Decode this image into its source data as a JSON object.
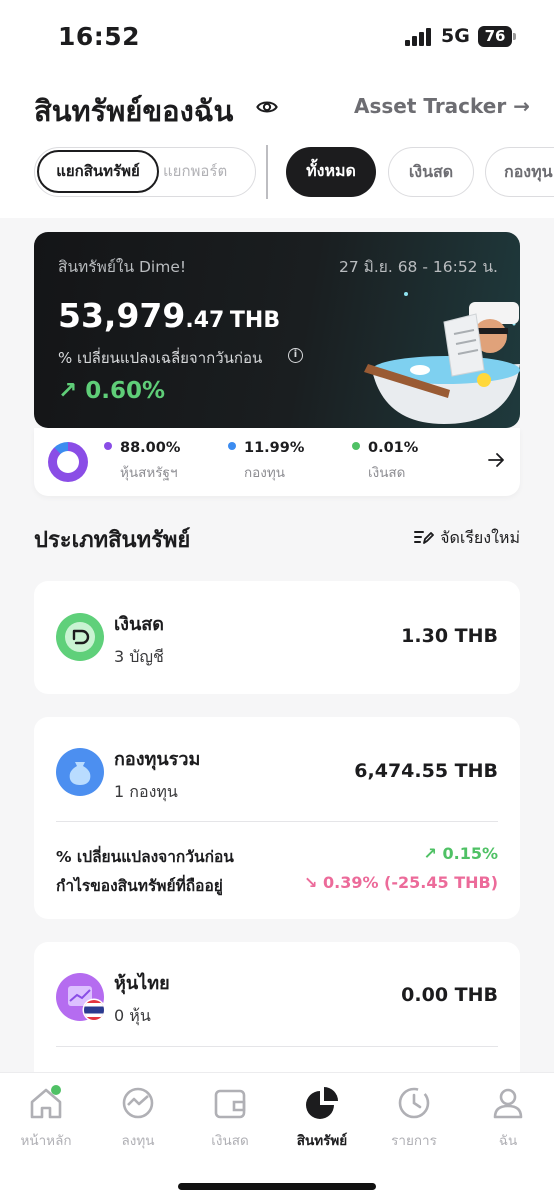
{
  "status_bar": {
    "time": "16:52",
    "network": "5G",
    "battery": "76"
  },
  "header": {
    "title": "สินทรัพย์ของฉัน",
    "tracker_link": "Asset Tracker →"
  },
  "segment": {
    "active": "แยกสินทรัพย์",
    "inactive": "แยกพอร์ต"
  },
  "filters": [
    "ทั้งหมด",
    "เงินสด",
    "กองทุน"
  ],
  "portfolio": {
    "label": "สินทรัพย์ใน Dime!",
    "date": "27 มิ.ย. 68 - 16:52 น.",
    "amount_main": "53,979",
    "amount_decimal": ".47",
    "currency": "THB",
    "change_caption": "% เปลี่ยนแปลงเฉลี่ยจากวันก่อน",
    "change_value": "↗ 0.60%",
    "change_color": "#5fce78"
  },
  "allocation": [
    {
      "pct": "88.00%",
      "name": "หุ้นสหรัฐฯ",
      "color": "#8a4de6"
    },
    {
      "pct": "11.99%",
      "name": "กองทุน",
      "color": "#3c8cf0"
    },
    {
      "pct": "0.01%",
      "name": "เงินสด",
      "color": "#4fc165"
    }
  ],
  "asset_types": {
    "title": "ประเภทสินทรัพย์",
    "reorder": "จัดเรียงใหม่",
    "items": [
      {
        "name": "เงินสด",
        "sub": "3 บัญชี",
        "value": "1.30 THB"
      },
      {
        "name": "กองทุนรวม",
        "sub": "1 กองทุน",
        "value": "6,474.55 THB",
        "change_label": "% เปลี่ยนแปลงจากวันก่อน",
        "change_value": "↗ 0.15%",
        "profit_label": "กำไรของสินทรัพย์ที่ถืออยู่",
        "profit_value": "↘ 0.39% (-25.45 THB)"
      },
      {
        "name": "หุ้นไทย",
        "sub": "0 หุ้น",
        "value": "0.00 THB"
      }
    ]
  },
  "tabs": [
    "หน้าหลัก",
    "ลงทุน",
    "เงินสด",
    "สินทรัพย์",
    "รายการ",
    "ฉัน"
  ],
  "colors": {
    "positive": "#4fc165",
    "negative": "#ec6b9a",
    "dark": "#1c1c1e"
  }
}
